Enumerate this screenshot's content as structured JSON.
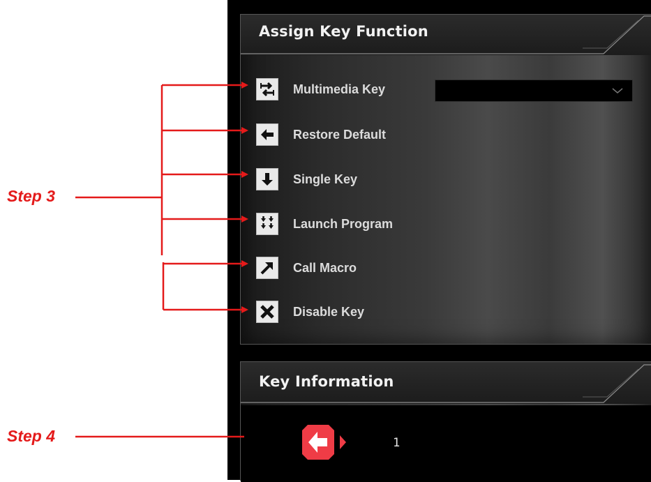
{
  "assign_panel": {
    "title": "Assign Key Function",
    "items": [
      {
        "label": "Multimedia Key",
        "icon": "swap-arrows-icon"
      },
      {
        "label": "Restore Default",
        "icon": "arrow-left-icon"
      },
      {
        "label": "Single Key",
        "icon": "arrow-down-icon"
      },
      {
        "label": "Launch Program",
        "icon": "quad-arrows-icon"
      },
      {
        "label": "Call Macro",
        "icon": "arrow-up-right-icon"
      },
      {
        "label": "Disable Key",
        "icon": "close-x-icon"
      }
    ],
    "multimedia_dropdown_value": ""
  },
  "key_info_panel": {
    "title": "Key Information",
    "key_icon": "mouse-back-button-icon",
    "key_value": "1"
  },
  "annotations": {
    "step3": "Step 3",
    "step4": "Step 4",
    "color": "#e41a1a"
  }
}
